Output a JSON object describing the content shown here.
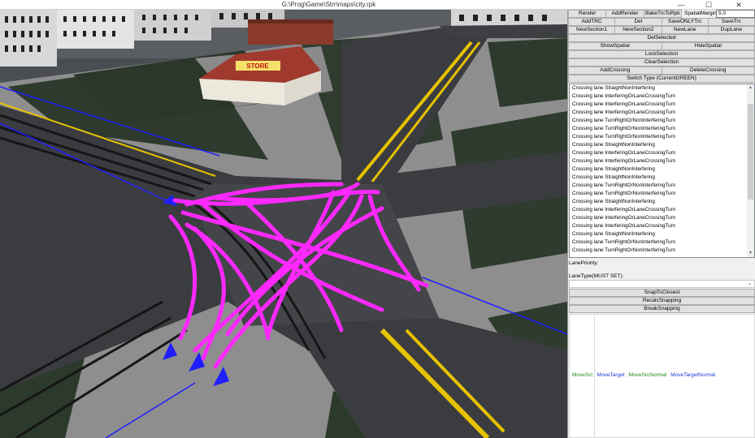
{
  "window": {
    "title": "G:\\Prog\\Game\\Strr\\maps\\city.rpk",
    "minimize_glyph": "—",
    "maximize_glyph": "☐",
    "close_glyph": "✕"
  },
  "scene": {
    "store_sign": "STORE",
    "colors": {
      "crossing_lane": "#ff28ff",
      "road_marking_yellow": "#e6c200",
      "lane_blue": "#1f1fff",
      "asphalt": "#3b3c40",
      "grass": "#2c3a2c",
      "sidewalk": "#8c8c8c"
    }
  },
  "toolbar": {
    "row1": [
      "Render",
      "AddRender",
      "BakeTrcToRpk"
    ],
    "spatial_margin_label": "SpatialMargin:",
    "spatial_margin_value": "5.0",
    "row2": [
      "AddTRC",
      "Del",
      "SaveONLYTrc",
      "SaveTrc"
    ],
    "row3": [
      "NewSection1",
      "NewSection2",
      "NewLane",
      "DupLane"
    ],
    "del_selected": "DelSelected",
    "row5": [
      "ShowSpatial",
      "HideSpatial"
    ],
    "lock_selection": "LockSelection",
    "clear_selection": "ClearSelection",
    "row8": [
      "AddCrossing",
      "DeleteCrossing"
    ],
    "switch_type": "Switch Type (CurrentGREEN)"
  },
  "lane_list": [
    "Crossing lane StraightNonInterfering",
    "Crossing lane InterferingOrLaneCrossingTurn",
    "Crossing lane InterferingOrLaneCrossingTurn",
    "Crossing lane InterferingOrLaneCrossingTurn",
    "Crossing lane TurnRightOrNonInterferingTurn",
    "Crossing lane TurnRightOrNonInterferingTurn",
    "Crossing lane TurnRightOrNonInterferingTurn",
    "Crossing lane StraightNonInterfering",
    "Crossing lane InterferingOrLaneCrossingTurn",
    "Crossing lane InterferingOrLaneCrossingTurn",
    "Crossing lane StraightNonInterfering",
    "Crossing lane StraightNonInterfering",
    "Crossing lane TurnRightOrNonInterferingTurn",
    "Crossing lane TurnRightOrNonInterferingTurn",
    "Crossing lane StraightNonInterfering",
    "Crossing lane InterferingOrLaneCrossingTurn",
    "Crossing lane InterferingOrLaneCrossingTurn",
    "Crossing lane InterferingOrLaneCrossingTurn",
    "Crossing lane StraightNonInterfering",
    "Crossing lane TurnRightOrNonInterferingTurn",
    "Crossing lane TurnRightOrNonInterferingTurn"
  ],
  "fields": {
    "lane_priority_label": "LanePriority:",
    "lane_type_label": "LaneType(MUST SET):",
    "lane_type_value": "",
    "dropdown_glyph": "⌄"
  },
  "snap": {
    "snap_to_closest": "SnapToClosest",
    "recalc_snapping": "RecalcSnapping",
    "break_snapping": "BreakSnapping"
  },
  "move_links": [
    {
      "label": "MoveSrc",
      "color": "#1a8a1a"
    },
    {
      "label": "MoveTarget",
      "color": "#1a3ad8"
    },
    {
      "label": "MoveSrcNormal",
      "color": "#1a8a1a"
    },
    {
      "label": "MoveTargetNormal",
      "color": "#1a3ad8"
    }
  ]
}
